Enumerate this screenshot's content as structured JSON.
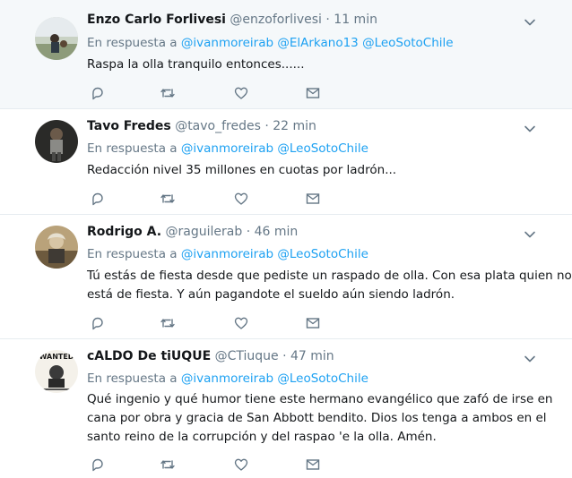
{
  "reply_prefix": "En respuesta a",
  "icons": {
    "reply": "reply-icon",
    "retweet": "retweet-icon",
    "like": "heart-icon",
    "dm": "envelope-icon",
    "more": "chevron-down-icon"
  },
  "colors": {
    "mention": "#1da1f2",
    "muted": "#657786",
    "highlight_bg": "#f5f8fa"
  },
  "tweets": [
    {
      "name": "Enzo Carlo Forlivesi",
      "handle": "@enzoforlivesi",
      "dot": "·",
      "time": "11 min",
      "mentions": [
        "@ivanmoreirab",
        "@ElArkano13",
        "@LeoSotoChile"
      ],
      "lines": [
        "Raspa la olla tranquilo entonces......"
      ]
    },
    {
      "name": "Tavo Fredes",
      "handle": "@tavo_fredes",
      "dot": "·",
      "time": "22 min",
      "mentions": [
        "@ivanmoreirab",
        "@LeoSotoChile"
      ],
      "lines": [
        "Redacción nivel 35 millones en cuotas por ladrón..."
      ]
    },
    {
      "name": "Rodrigo A.",
      "handle": "@raguilerab",
      "dot": "·",
      "time": "46 min",
      "mentions": [
        "@ivanmoreirab",
        "@LeoSotoChile"
      ],
      "lines": [
        "Tú estás de fiesta desde que pediste un raspado de olla. Con esa plata quien no",
        "está de fiesta. Y aún pagandote el sueldo aún siendo ladrón."
      ]
    },
    {
      "name": "cALDO De tiUQUE",
      "handle": "@CTiuque",
      "dot": "·",
      "time": "47 min",
      "mentions": [
        "@ivanmoreirab",
        "@LeoSotoChile"
      ],
      "avatar_text": "WANTED",
      "lines": [
        "Qué ingenio y qué humor tiene este hermano evangélico que zafó de irse en",
        "cana por obra y gracia de San Abbott bendito. Dios los tenga a ambos en el",
        "santo reino de la corrupción y del raspao 'e la olla. Amén."
      ]
    }
  ]
}
